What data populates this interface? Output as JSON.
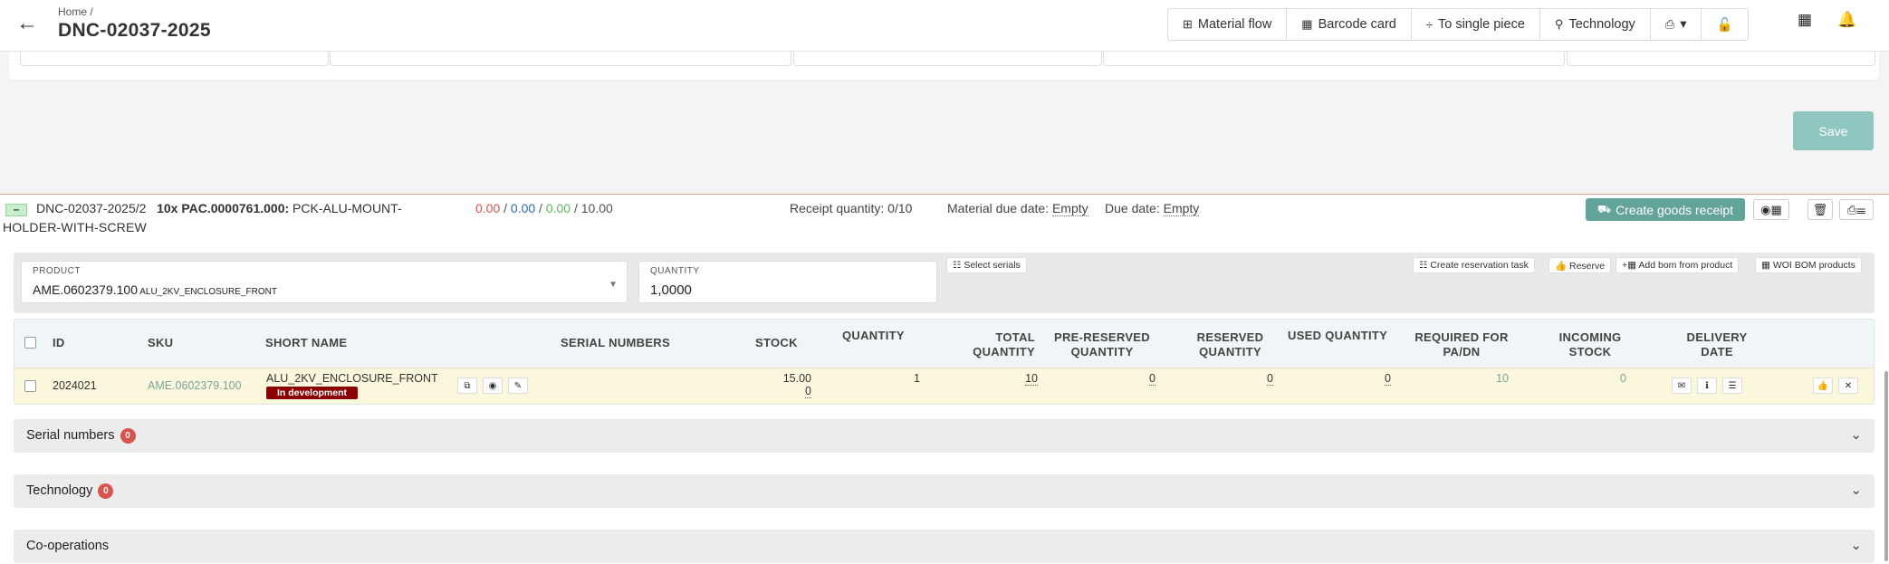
{
  "header": {
    "breadcrumb": "Home  /",
    "title": "DNC-02037-2025",
    "back_icon": "arrow-left-icon",
    "toolbar": [
      {
        "icon": "⊞",
        "label": "Material flow"
      },
      {
        "icon": "▦",
        "label": "Barcode card"
      },
      {
        "icon": "÷",
        "label": "To single piece"
      },
      {
        "icon": "⚲",
        "label": "Technology"
      },
      {
        "icon": "⎙",
        "label": "▾"
      },
      {
        "icon": "🔓",
        "label": ""
      }
    ],
    "grid_icon": "▦",
    "bell_icon": "🔔"
  },
  "form": {
    "save_label": "Save"
  },
  "item": {
    "collapse_label": "–",
    "code": "DNC-02037-2025/2",
    "bold_part": "10x PAC.0000761.000:",
    "name_part1": " PCK-ALU-MOUNT-",
    "name_part2": "HOLDER-WITH-SCREW",
    "stat_red": "0.00",
    "stat_blue": "0.00",
    "stat_green": "0.00",
    "stat_total": "10.00",
    "sep": " / ",
    "receipt_label": "Receipt quantity: 0/10",
    "material_due_label": "Material due date: ",
    "material_due_value": "Empty",
    "due_label": "Due date: ",
    "due_value": "Empty",
    "goods_receipt_label": "Create goods receipt",
    "goods_receipt_icon": "⛟"
  },
  "panel": {
    "product_label": "PRODUCT",
    "product_code": "AME.0602379.100",
    "product_name": " ALU_2KV_ENCLOSURE_FRONT",
    "quantity_label": "QUANTITY",
    "quantity_value": "1,0000",
    "select_serials": "☷ Select serials",
    "create_reservation": "☷ Create reservation task",
    "reserve": "👍 Reserve",
    "add_bom": "+▦ Add bom from product",
    "woi_bom": "▦ WOI BOM products"
  },
  "table": {
    "headers": {
      "id": "ID",
      "sku": "SKU",
      "short_name": "SHORT NAME",
      "serials": "SERIAL NUMBERS",
      "stock": "STOCK",
      "quantity": "QUANTITY",
      "total_quantity_1": "TOTAL",
      "total_quantity_2": "QUANTITY",
      "pre_reserved_1": "PRE-RESERVED",
      "pre_reserved_2": "QUANTITY",
      "reserved_1": "RESERVED",
      "reserved_2": "QUANTITY",
      "used_quantity": "USED QUANTITY",
      "required_1": "REQUIRED FOR",
      "required_2": "PA/DN",
      "incoming_1": "INCOMING",
      "incoming_2": "STOCK",
      "delivery_1": "DELIVERY",
      "delivery_2": "DATE"
    },
    "row": {
      "id": "2024021",
      "sku": "AME.0602379.100",
      "short_name": "ALU_2KV_ENCLOSURE_FRONT",
      "badge": "In development",
      "stock_1": "15.00",
      "stock_2": "0",
      "quantity": "1",
      "total_quantity": "10",
      "pre_reserved": "0",
      "reserved": "0",
      "used": "0",
      "required": "10",
      "incoming": "0"
    }
  },
  "accordions": [
    {
      "label": "Serial numbers",
      "count": "0"
    },
    {
      "label": "Technology",
      "count": "0"
    },
    {
      "label": "Co-operations",
      "count": ""
    }
  ]
}
